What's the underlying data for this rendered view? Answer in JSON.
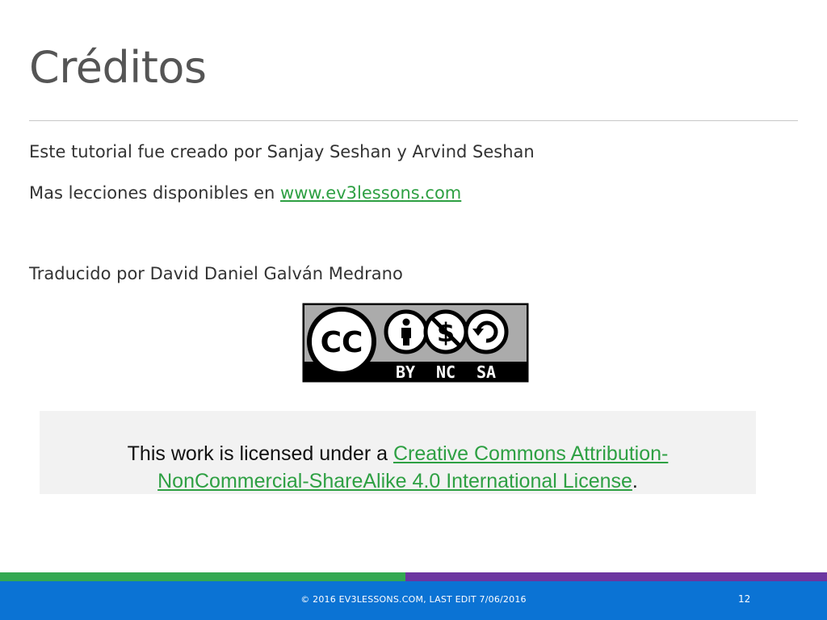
{
  "slide": {
    "title": "Créditos",
    "line1": "Este tutorial fue creado por Sanjay Seshan y Arvind Seshan",
    "line2_prefix": "Mas lecciones disponibles en ",
    "line2_link": "www.ev3lessons.com",
    "line3": "Traducido por David Daniel Galván Medrano"
  },
  "cc_badge": {
    "logo": "CC",
    "labels": [
      "BY",
      "NC",
      "SA"
    ],
    "icons": [
      "cc-icon",
      "attribution-icon",
      "noncommercial-icon",
      "sharealike-icon"
    ]
  },
  "license": {
    "prefix": "This work is licensed under a ",
    "link_line1": "Creative Commons Attribution-",
    "link_line2": "NonCommercial-ShareAlike 4.0 International License",
    "suffix": "."
  },
  "footer": {
    "text": "© 2016 EV3LESSONS.COM, LAST EDIT 7/06/2016",
    "page_number": "12"
  },
  "colors": {
    "link": "#2ea043",
    "footer_bg": "#0b73d4",
    "stripe_green": "#33a852",
    "stripe_purple": "#6b35a0"
  }
}
